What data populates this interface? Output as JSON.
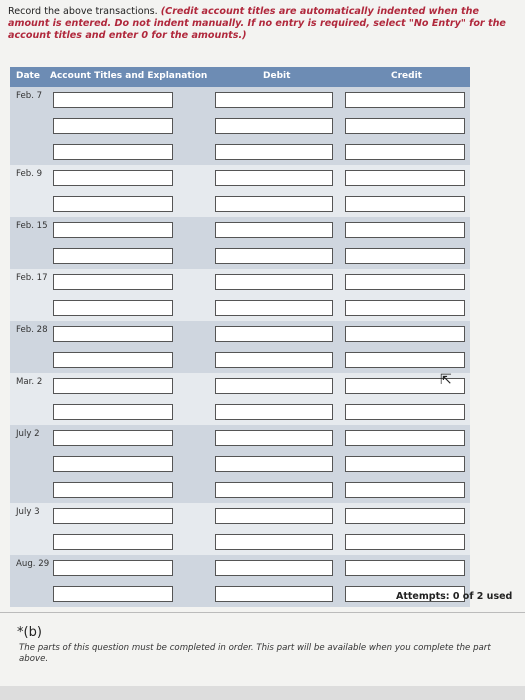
{
  "instructions": {
    "lead": "Record the above transactions.",
    "note": "(Credit account titles are automatically indented when the amount is entered. Do not indent manually. If no entry is required, select \"No Entry\" for the account titles and enter 0 for the amounts.)"
  },
  "table": {
    "headers": {
      "date": "Date",
      "account": "Account Titles and Explanation",
      "debit": "Debit",
      "credit": "Credit"
    },
    "groups": [
      {
        "date": "Feb. 7",
        "lines": 3
      },
      {
        "date": "Feb. 9",
        "lines": 2
      },
      {
        "date": "Feb. 15",
        "lines": 2
      },
      {
        "date": "Feb. 17",
        "lines": 2
      },
      {
        "date": "Feb. 28",
        "lines": 2
      },
      {
        "date": "Mar. 2",
        "lines": 2
      },
      {
        "date": "July 2",
        "lines": 3
      },
      {
        "date": "July 3",
        "lines": 2
      },
      {
        "date": "Aug. 29",
        "lines": 2
      }
    ]
  },
  "attempts": "Attempts: 0 of 2 used",
  "part_b": {
    "label": "*(b)",
    "note": "The parts of this question must be completed in order. This part will be available when you complete the part above."
  }
}
